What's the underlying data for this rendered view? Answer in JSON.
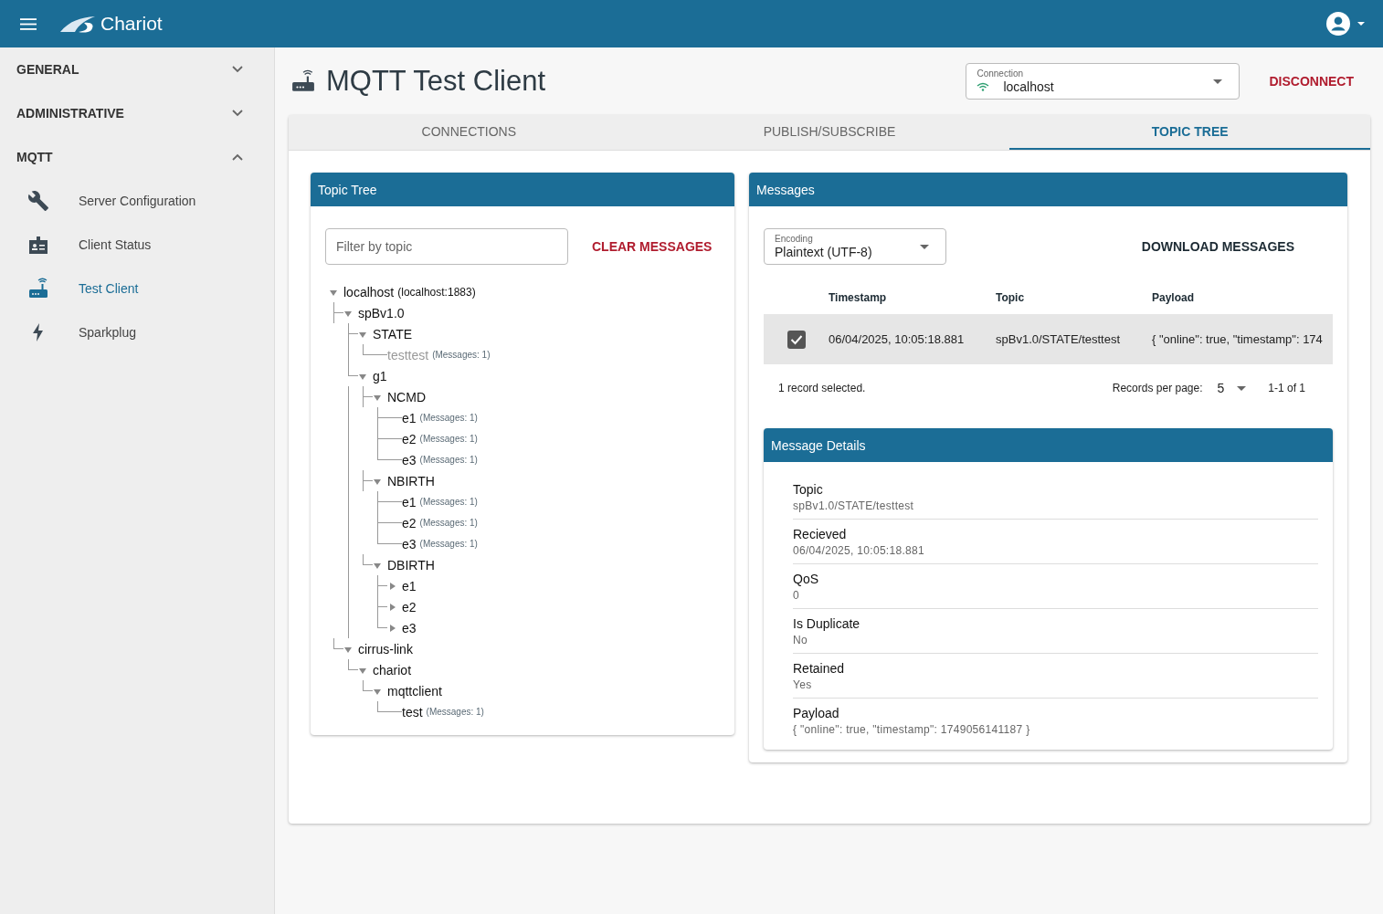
{
  "app_bar": {
    "brand": "Chariot"
  },
  "sidebar": {
    "sections": [
      {
        "label": "GENERAL",
        "expanded": false
      },
      {
        "label": "ADMINISTRATIVE",
        "expanded": false
      },
      {
        "label": "MQTT",
        "expanded": true,
        "items": [
          {
            "label": "Server Configuration",
            "selected": false
          },
          {
            "label": "Client Status",
            "selected": false
          },
          {
            "label": "Test Client",
            "selected": true
          },
          {
            "label": "Sparkplug",
            "selected": false
          }
        ]
      }
    ]
  },
  "page": {
    "title": "MQTT Test Client",
    "connection": {
      "label": "Connection",
      "value": "localhost"
    },
    "disconnect": "DISCONNECT"
  },
  "tabs": [
    {
      "label": "CONNECTIONS",
      "selected": false
    },
    {
      "label": "PUBLISH/SUBSCRIBE",
      "selected": false
    },
    {
      "label": "TOPIC TREE",
      "selected": true
    }
  ],
  "topic_tree": {
    "title": "Topic Tree",
    "filter": {
      "placeholder": "Filter by topic"
    },
    "clear": "CLEAR MESSAGES",
    "tree": [
      {
        "label": "localhost",
        "note": "(localhost:1883)",
        "kind": "branch",
        "expanded": true,
        "greyed": false,
        "children": [
          {
            "label": "spBv1.0",
            "kind": "branch",
            "expanded": true,
            "greyed": false,
            "children": [
              {
                "label": "STATE",
                "kind": "branch",
                "expanded": true,
                "greyed": false,
                "children": [
                  {
                    "label": "testtest",
                    "count": "(Messages: 1)",
                    "kind": "leaf",
                    "greyed": true
                  }
                ]
              },
              {
                "label": "g1",
                "kind": "branch",
                "expanded": true,
                "greyed": false,
                "children": [
                  {
                    "label": "NCMD",
                    "kind": "branch",
                    "expanded": true,
                    "greyed": false,
                    "children": [
                      {
                        "label": "e1",
                        "count": "(Messages: 1)",
                        "kind": "leaf",
                        "greyed": false
                      },
                      {
                        "label": "e2",
                        "count": "(Messages: 1)",
                        "kind": "leaf",
                        "greyed": false
                      },
                      {
                        "label": "e3",
                        "count": "(Messages: 1)",
                        "kind": "leaf",
                        "greyed": false
                      }
                    ]
                  },
                  {
                    "label": "NBIRTH",
                    "kind": "branch",
                    "expanded": true,
                    "greyed": false,
                    "children": [
                      {
                        "label": "e1",
                        "count": "(Messages: 1)",
                        "kind": "leaf",
                        "greyed": false
                      },
                      {
                        "label": "e2",
                        "count": "(Messages: 1)",
                        "kind": "leaf",
                        "greyed": false
                      },
                      {
                        "label": "e3",
                        "count": "(Messages: 1)",
                        "kind": "leaf",
                        "greyed": false
                      }
                    ]
                  },
                  {
                    "label": "DBIRTH",
                    "kind": "branch",
                    "expanded": true,
                    "greyed": false,
                    "children": [
                      {
                        "label": "e1",
                        "kind": "branch",
                        "expanded": false,
                        "greyed": false
                      },
                      {
                        "label": "e2",
                        "kind": "branch",
                        "expanded": false,
                        "greyed": false
                      },
                      {
                        "label": "e3",
                        "kind": "branch",
                        "expanded": false,
                        "greyed": false
                      }
                    ]
                  }
                ]
              }
            ]
          },
          {
            "label": "cirrus-link",
            "kind": "branch",
            "expanded": true,
            "greyed": false,
            "children": [
              {
                "label": "chariot",
                "kind": "branch",
                "expanded": true,
                "greyed": false,
                "children": [
                  {
                    "label": "mqttclient",
                    "kind": "branch",
                    "expanded": true,
                    "greyed": false,
                    "children": [
                      {
                        "label": "test",
                        "count": "(Messages: 1)",
                        "kind": "leaf",
                        "greyed": false
                      }
                    ]
                  }
                ]
              }
            ]
          }
        ]
      }
    ]
  },
  "messages": {
    "title": "Messages",
    "encoding": {
      "label": "Encoding",
      "value": "Plaintext (UTF-8)"
    },
    "download": "DOWNLOAD MESSAGES",
    "columns": [
      "Timestamp",
      "Topic",
      "Payload"
    ],
    "rows": [
      {
        "selected": true,
        "cells": [
          "06/04/2025, 10:05:18.881",
          "spBv1.0/STATE/testtest",
          "{ \"online\": true, \"timestamp\": 174"
        ]
      }
    ],
    "footer": {
      "selection": "1 record selected.",
      "per_page_label": "Records per page:",
      "per_page": "5",
      "range": "1-1 of 1"
    }
  },
  "details": {
    "title": "Message Details",
    "fields": [
      {
        "label": "Topic",
        "value": "spBv1.0/STATE/testtest"
      },
      {
        "label": "Recieved",
        "value": "06/04/2025, 10:05:18.881"
      },
      {
        "label": "QoS",
        "value": "0"
      },
      {
        "label": "Is Duplicate",
        "value": "No"
      },
      {
        "label": "Retained",
        "value": "Yes"
      },
      {
        "label": "Payload",
        "value": "{ \"online\": true, \"timestamp\": 1749056141187 }"
      }
    ]
  }
}
